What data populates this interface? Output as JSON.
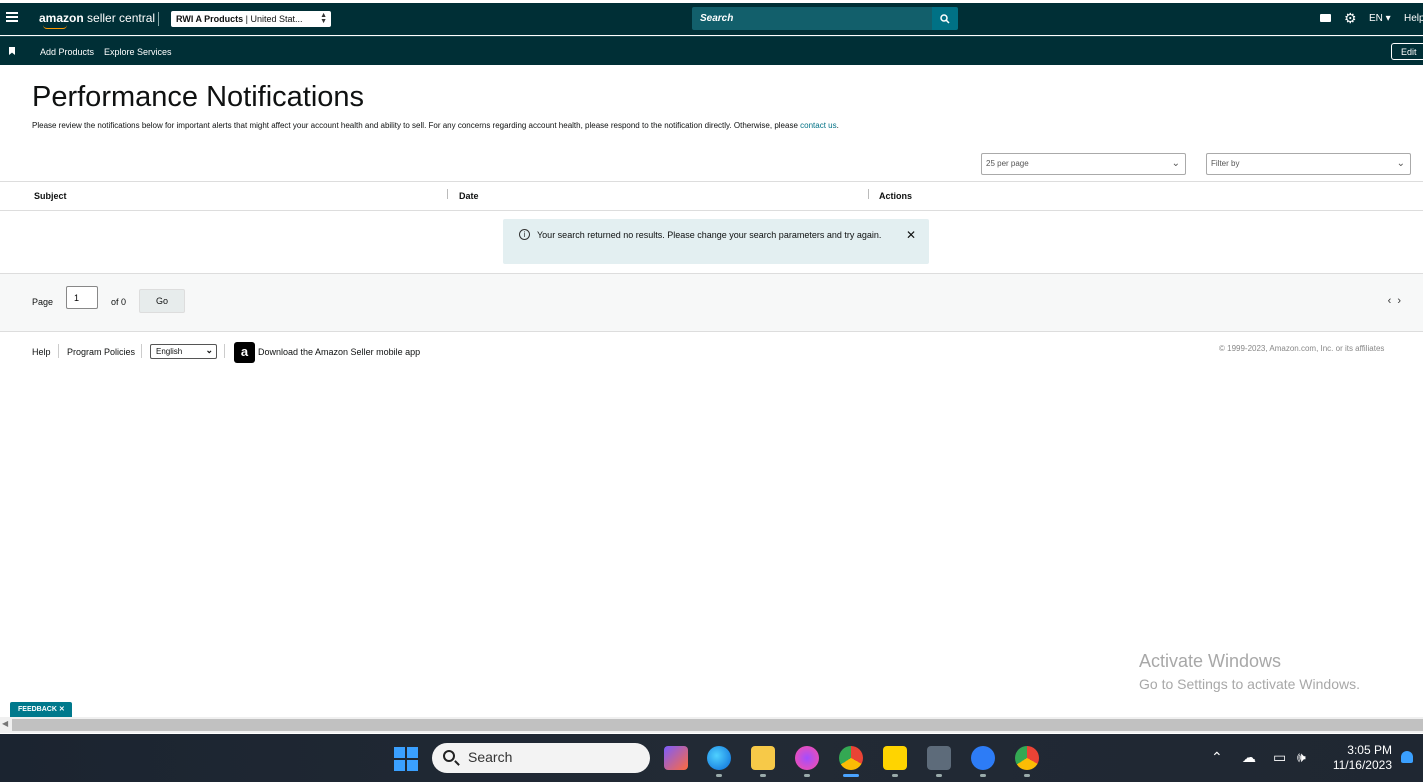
{
  "header": {
    "logo_brand": "amazon",
    "logo_suffix": " seller central",
    "store_name": "RWI A Products",
    "store_region": " | United Stat...",
    "search_placeholder": "Search",
    "lang": "EN ▾",
    "help": "Help"
  },
  "nav": {
    "items": [
      {
        "label": "Add Products"
      },
      {
        "label": "Explore Services"
      }
    ],
    "edit": "Edit"
  },
  "page": {
    "title": "Performance Notifications",
    "description": "Please review the notifications below for important alerts that might affect your account health and ability to sell. For any concerns regarding account health, please respond to the notification directly. Otherwise, please ",
    "contact_link": "contact us",
    "description_end": ".",
    "per_page": "25 per page",
    "filter_placeholder": "Filter by"
  },
  "table": {
    "columns": [
      "Subject",
      "Date",
      "Actions"
    ],
    "alert": "Your search returned no results. Please change your search parameters and try again."
  },
  "pager": {
    "page_label": "Page",
    "page_value": "1",
    "of_label": "of 0",
    "go": "Go"
  },
  "footer": {
    "help": "Help",
    "policies": "Program Policies",
    "language": "English",
    "app_text": "Download the Amazon Seller mobile app",
    "copyright": "© 1999-2023, Amazon.com, Inc. or its affiliates"
  },
  "overlay": {
    "watermark_title": "Activate Windows",
    "watermark_sub": "Go to Settings to activate Windows.",
    "feedback": "FEEDBACK ✕"
  },
  "taskbar": {
    "search": "Search",
    "time": "3:05 PM",
    "date": "11/16/2023"
  },
  "colors": {
    "header_bg": "#002f36",
    "search_bg": "#125f6b",
    "search_btn": "#007185",
    "alert_bg": "#e3eff1",
    "link": "#007185",
    "feedback_bg": "#00798c"
  }
}
